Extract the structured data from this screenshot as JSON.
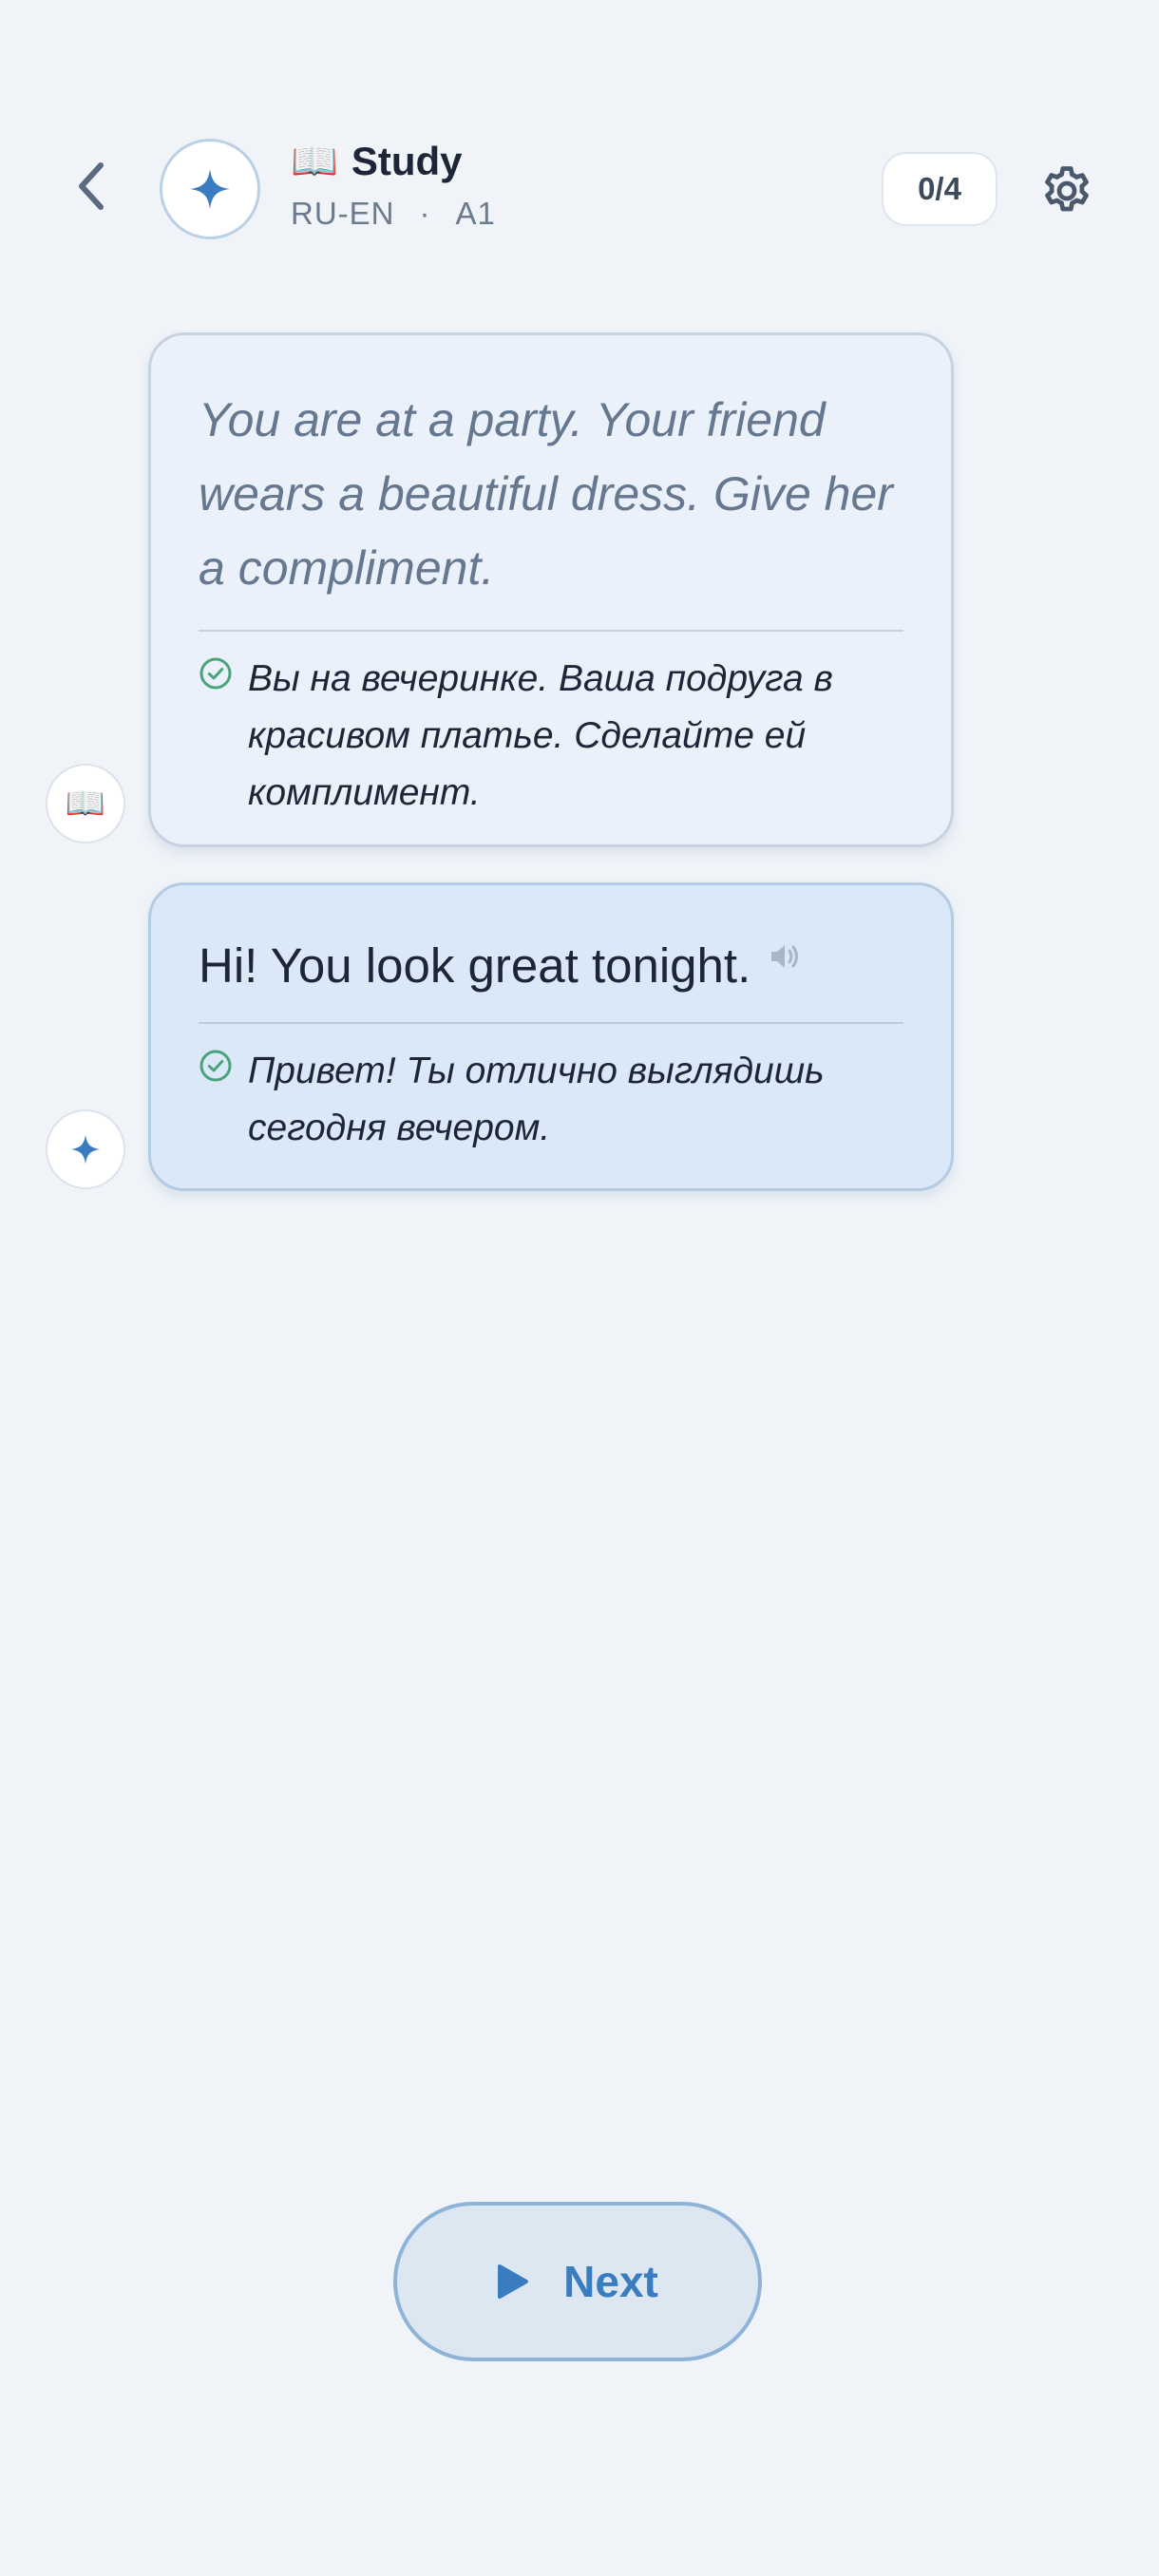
{
  "header": {
    "title_emoji": "📖",
    "title": "Study",
    "lang_pair": "RU-EN",
    "separator": "·",
    "level": "A1",
    "progress": "0/4"
  },
  "messages": [
    {
      "role": "scenario",
      "avatar_emoji": "📖",
      "text": "You are at a party. Your friend wears a beautiful dress. Give her a compliment.",
      "translation": "Вы на вечеринке. Ваша подруга в красивом платье. Сделайте ей комплимент."
    },
    {
      "role": "assistant",
      "text": "Hi! You look great tonight.",
      "translation": "Привет! Ты отлично выглядишь сегодня вечером."
    }
  ],
  "actions": {
    "next_label": "Next"
  },
  "colors": {
    "background": "#f0f4f9",
    "accent": "#3a7cc0",
    "check_green": "#4aa37a",
    "prompt_card": "#eaf1fa",
    "reply_card": "#dbe8f7"
  },
  "icons": {
    "back": "chevron-left-icon",
    "avatar": "sparkle-icon",
    "settings": "gear-icon",
    "speaker": "speaker-icon",
    "check": "check-circle-icon",
    "play": "play-icon"
  }
}
